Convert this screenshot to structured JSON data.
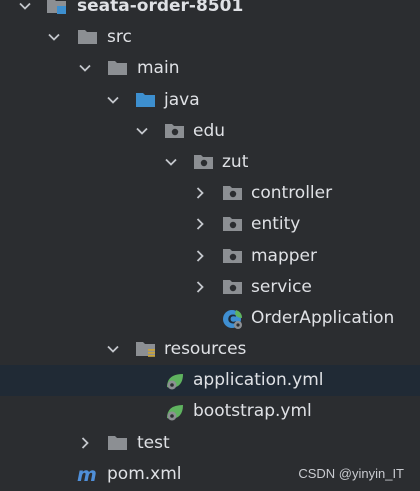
{
  "tree": {
    "root": "seata-order-8501",
    "src": "src",
    "main": "main",
    "java": "java",
    "edu": "edu",
    "zut": "zut",
    "controller": "controller",
    "entity": "entity",
    "mapper": "mapper",
    "service": "service",
    "order_application": "OrderApplication",
    "resources": "resources",
    "application_yml": "application.yml",
    "bootstrap_yml": "bootstrap.yml",
    "test": "test",
    "pom_xml": "pom.xml"
  },
  "selected_item": "application.yml",
  "watermark": "CSDN @yinyin_IT",
  "icons": {
    "chevron_expanded": "chevron-down-icon",
    "chevron_collapsed": "chevron-right-icon",
    "module": "module-folder-icon",
    "folder": "folder-icon",
    "source_folder": "source-root-folder-icon",
    "package": "package-icon",
    "resources_folder": "resources-folder-icon",
    "spring_boot_class": "spring-boot-class-icon",
    "spring_config": "spring-config-file-icon",
    "maven": "maven-pom-icon"
  },
  "colors": {
    "background": "#2b2d30",
    "selection": "#202a35",
    "text": "#dfe1e5",
    "folder": "#8c8f93",
    "source_folder": "#3d8fcf",
    "resources_badge": "#c7a33e",
    "spring_green": "#5fb35f",
    "maven_blue": "#4f8fd9"
  }
}
